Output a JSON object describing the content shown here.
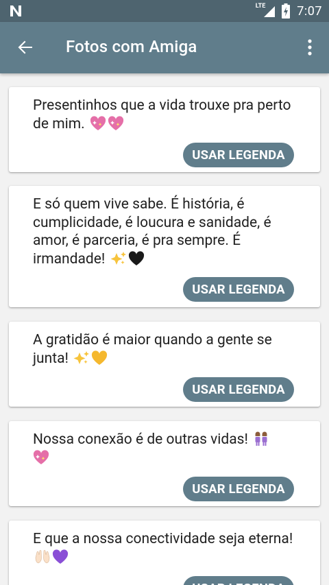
{
  "statusbar": {
    "network": "LTE",
    "time": "7:07"
  },
  "appbar": {
    "title": "Fotos com Amiga"
  },
  "captions": [
    {
      "text": "Presentinhos que a vida trouxe pra perto de mim.",
      "emojis": [
        "sparkling-heart",
        "sparkling-heart"
      ],
      "button": "USAR LEGENDA"
    },
    {
      "text": "E só quem vive sabe. É história, é cumplicidade, é loucura e sanidade, é amor, é parceria, é pra sempre. É irmandade!",
      "emojis": [
        "sparkles",
        "black-heart"
      ],
      "button": "USAR LEGENDA"
    },
    {
      "text": "A gratidão é maior quando a gente se junta!",
      "emojis": [
        "sparkles",
        "yellow-heart"
      ],
      "button": "USAR LEGENDA"
    },
    {
      "text": "Nossa conexão é de outras vidas!",
      "emojis": [
        "two-women",
        "sparkling-heart"
      ],
      "button": "USAR LEGENDA"
    },
    {
      "text": "E que a nossa conectividade seja eterna!",
      "emojis": [
        "raised-hands",
        "purple-heart"
      ],
      "button": "USAR LEGENDA"
    }
  ],
  "colors": {
    "statusbar": "#4e646f",
    "appbar": "#607d8b",
    "button": "#607d8b",
    "background": "#f2f2f2"
  }
}
